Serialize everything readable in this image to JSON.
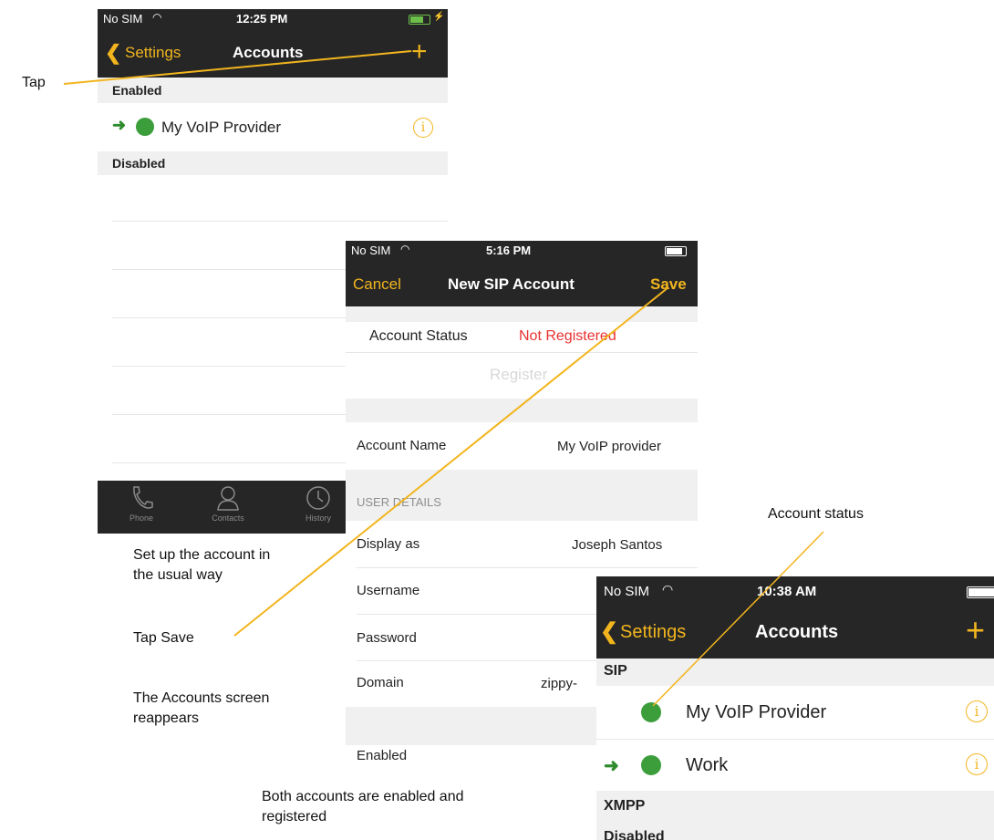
{
  "annotations": {
    "tap": "Tap",
    "setup_line1": "Set up the account in",
    "setup_line2": "the usual way",
    "tap_save": "Tap Save",
    "reappears_line1": "The Accounts screen",
    "reappears_line2": "reappears",
    "account_status": "Account status",
    "both_line1": "Both accounts are enabled and",
    "both_line2": "registered"
  },
  "screen1": {
    "status": {
      "carrier": "No SIM",
      "time": "12:25 PM"
    },
    "nav": {
      "back": "Settings",
      "title": "Accounts",
      "add": "+"
    },
    "sections": {
      "enabled": "Enabled",
      "disabled": "Disabled"
    },
    "account": {
      "name": "My VoIP Provider"
    },
    "tabs": {
      "phone": "Phone",
      "contacts": "Contacts",
      "history": "History"
    }
  },
  "screen2": {
    "status": {
      "carrier": "No SIM",
      "time": "5:16 PM"
    },
    "nav": {
      "cancel": "Cancel",
      "title": "New SIP Account",
      "save": "Save"
    },
    "account_status_label": "Account Status",
    "account_status_value": "Not Registered",
    "register_button": "Register",
    "account_name_label": "Account Name",
    "account_name_value": "My VoIP provider",
    "user_details_header": "USER DETAILS",
    "display_as_label": "Display as",
    "display_as_value": "Joseph Santos",
    "username_label": "Username",
    "password_label": "Password",
    "domain_label": "Domain",
    "domain_value": "zippy-",
    "enabled_label": "Enabled"
  },
  "screen3": {
    "status": {
      "carrier": "No SIM",
      "time": "10:38 AM"
    },
    "nav": {
      "back": "Settings",
      "title": "Accounts",
      "add": "+"
    },
    "sections": {
      "sip": "SIP",
      "xmpp": "XMPP",
      "disabled": "Disabled"
    },
    "accounts": [
      {
        "name": "My VoIP Provider"
      },
      {
        "name": "Work"
      }
    ]
  },
  "colors": {
    "accent": "#f2b51e",
    "bar": "#262626",
    "error": "#e8312f",
    "online": "#3b9e3b",
    "arrow": "#2e8b2e"
  }
}
